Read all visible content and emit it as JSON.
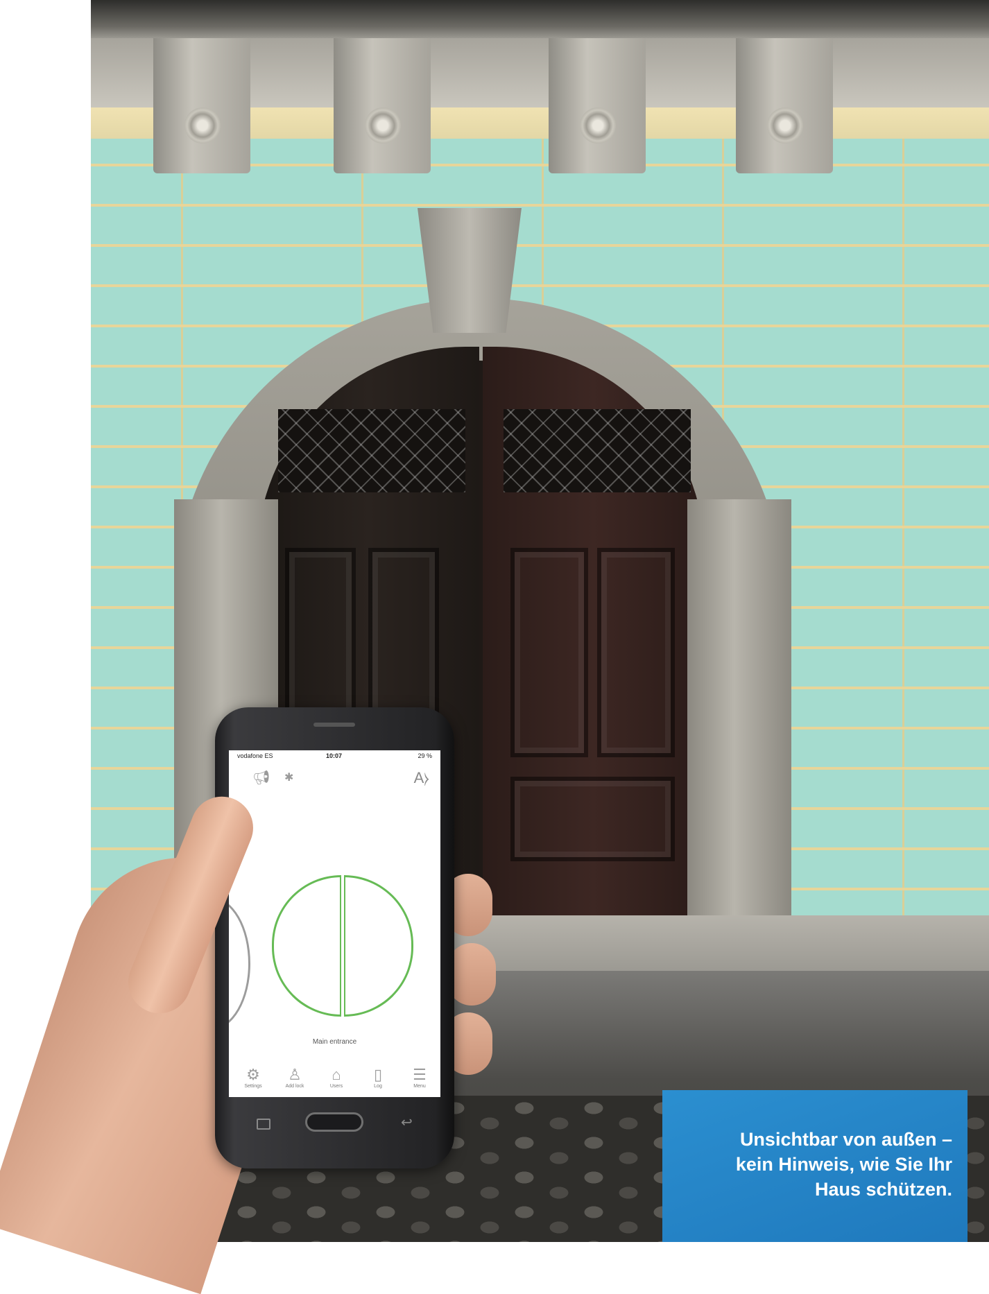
{
  "phone_app": {
    "status_bar": {
      "carrier": "vodafone ES",
      "time": "10:07",
      "battery": "29 %"
    },
    "top_icons": [
      "megaphone-icon",
      "bluetooth-icon",
      "accessibility-text-icon"
    ],
    "aa_label": "A",
    "lock_name": "Main entrance",
    "lock_color": "#66bb55",
    "tabs": [
      {
        "label": "Settings",
        "icon": "gear-icon"
      },
      {
        "label": "Add lock",
        "icon": "add-lock-icon"
      },
      {
        "label": "Users",
        "icon": "user-icon"
      },
      {
        "label": "Log",
        "icon": "log-icon"
      },
      {
        "label": "Menu",
        "icon": "menu-icon"
      }
    ]
  },
  "caption": {
    "lines": [
      "Unsichtbar von außen –",
      "kein Hinweis, wie Sie Ihr",
      "Haus schützen."
    ],
    "background": "#2b8fd0"
  }
}
